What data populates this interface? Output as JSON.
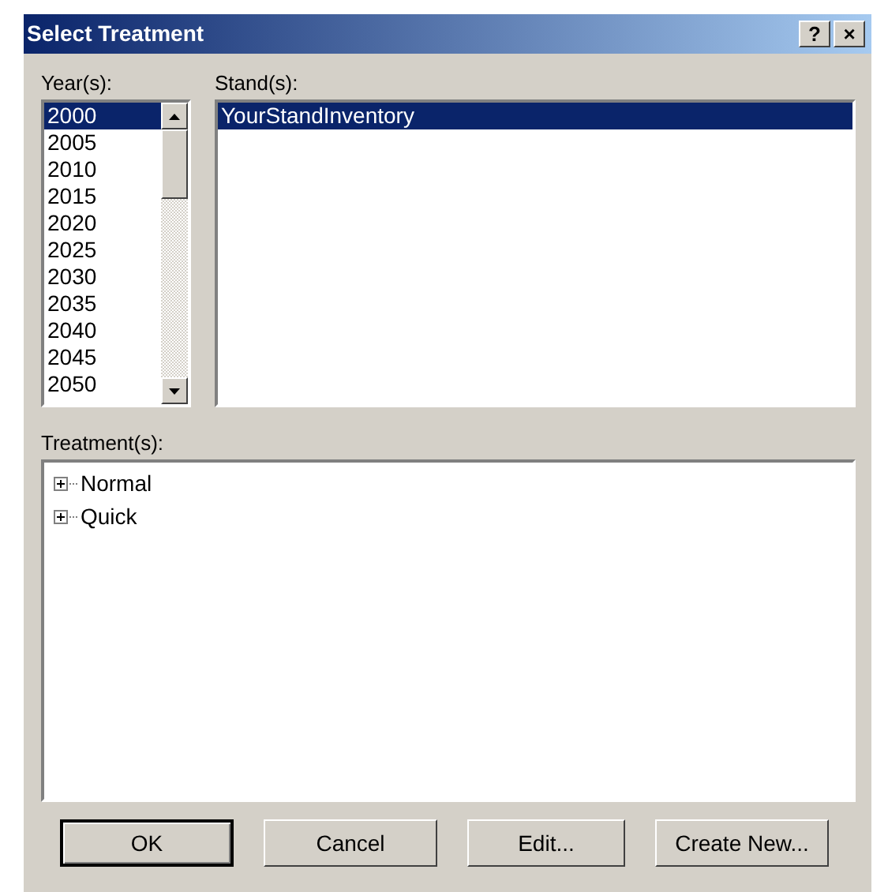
{
  "window": {
    "title": "Select Treatment",
    "buttons": [
      "?",
      "×"
    ]
  },
  "years": {
    "label": "Year(s):",
    "items": [
      {
        "text": "2000",
        "selected": true
      },
      {
        "text": "2005",
        "selected": false
      },
      {
        "text": "2010",
        "selected": false
      },
      {
        "text": "2015",
        "selected": false
      },
      {
        "text": "2020",
        "selected": false
      },
      {
        "text": "2025",
        "selected": false
      },
      {
        "text": "2030",
        "selected": false
      },
      {
        "text": "2035",
        "selected": false
      },
      {
        "text": "2040",
        "selected": false
      },
      {
        "text": "2045",
        "selected": false
      },
      {
        "text": "2050",
        "selected": false
      }
    ]
  },
  "stands": {
    "label": "Stand(s):",
    "items": [
      {
        "text": "YourStandInventory",
        "selected": true
      }
    ]
  },
  "treatments": {
    "label": "Treatment(s):",
    "items": [
      {
        "text": "Normal",
        "expanded": false
      },
      {
        "text": "Quick",
        "expanded": false
      }
    ]
  },
  "buttons": [
    {
      "label": "OK",
      "default": true
    },
    {
      "label": "Cancel",
      "default": false
    },
    {
      "label": "Edit...",
      "default": false
    },
    {
      "label": "Create New...",
      "default": false
    }
  ]
}
